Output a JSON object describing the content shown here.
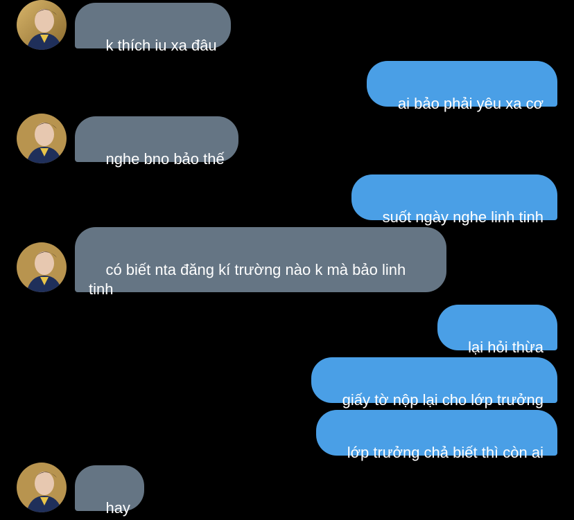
{
  "conversation": {
    "messages": [
      {
        "sender": "contact",
        "text": "k thích iu xa đâu"
      },
      {
        "sender": "me",
        "text": "ai bảo phải yêu xa cơ"
      },
      {
        "sender": "contact",
        "text": "nghe bno bảo thế"
      },
      {
        "sender": "me",
        "text": "suốt ngày nghe linh tinh"
      },
      {
        "sender": "contact",
        "text": "có biết nta đăng kí trường nào k mà bảo linh tinh"
      },
      {
        "sender": "me",
        "text": "lại hỏi thừa"
      },
      {
        "sender": "me",
        "text": "giấy tờ nộp lại cho lớp trưởng"
      },
      {
        "sender": "me",
        "text": "lớp trưởng chả biết thì còn ai"
      },
      {
        "sender": "contact",
        "text": "hay"
      }
    ]
  },
  "colors": {
    "background": "#000000",
    "incoming_bubble": "#657584",
    "outgoing_bubble": "#4a9fe6",
    "text": "#ffffff"
  }
}
